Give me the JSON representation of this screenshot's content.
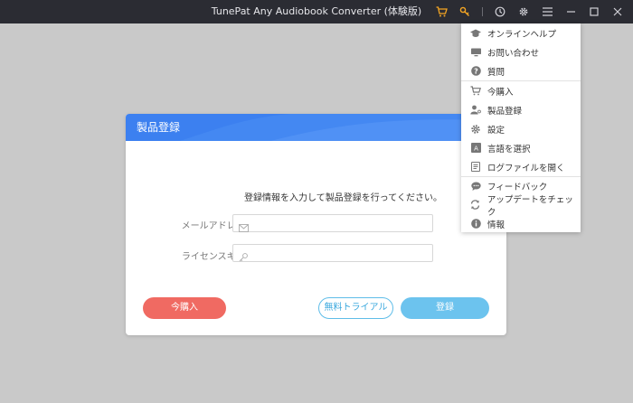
{
  "window": {
    "title": "TunePat Any Audiobook Converter (体験版)",
    "colors": {
      "titlebar": "#2b2c33",
      "accent": "#3c80f0",
      "buy": "#f06a62",
      "register": "#6cc3ee",
      "cart": "#f5a623"
    },
    "controls": [
      "cart-icon",
      "key-icon",
      "clock-icon",
      "gear-icon",
      "hamburger-icon",
      "minimize-icon",
      "maximize-icon",
      "close-icon"
    ]
  },
  "dialog": {
    "title": "製品登録",
    "message": "登録情報を入力して製品登録を行ってください。",
    "email_label": "メールアドレス:",
    "email_value": "",
    "key_label": "ライセンスキー:",
    "key_value": "",
    "buy_label": "今購入",
    "trial_label": "無料トライアル",
    "register_label": "登録"
  },
  "menu": {
    "items": [
      {
        "label": "オンラインヘルプ",
        "icon": "graduation-cap-icon"
      },
      {
        "label": "お問い合わせ",
        "icon": "monitor-icon"
      },
      {
        "label": "質問",
        "icon": "question-icon"
      },
      {
        "label": "今購入",
        "icon": "cart-icon"
      },
      {
        "label": "製品登録",
        "icon": "user-key-icon"
      },
      {
        "label": "設定",
        "icon": "gear-icon"
      },
      {
        "label": "言語を選択",
        "icon": "language-icon"
      },
      {
        "label": "ログファイルを開く",
        "icon": "document-icon"
      },
      {
        "label": "フィードバック",
        "icon": "chat-icon"
      },
      {
        "label": "アップデートをチェック",
        "icon": "refresh-icon"
      },
      {
        "label": "情報",
        "icon": "info-icon"
      }
    ]
  }
}
